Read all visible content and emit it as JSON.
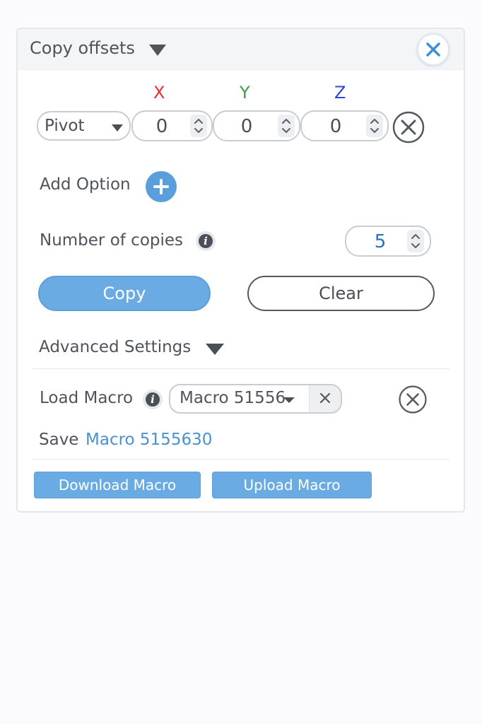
{
  "panel": {
    "title": "Copy offsets",
    "close_icon": "close-icon"
  },
  "axes": {
    "x": "X",
    "y": "Y",
    "z": "Z"
  },
  "axis_colors": {
    "x": "#e0322f",
    "y": "#3b9b4a",
    "z": "#2f47d9"
  },
  "offset_row": {
    "mode": "Pivot",
    "x": "0",
    "y": "0",
    "z": "0"
  },
  "add_option": {
    "label": "Add Option"
  },
  "copies": {
    "label": "Number of copies",
    "value": "5"
  },
  "actions": {
    "copy": "Copy",
    "clear": "Clear"
  },
  "advanced": {
    "label": "Advanced Settings"
  },
  "macro": {
    "load_label": "Load Macro",
    "selected": "Macro 51556",
    "save_label": "Save",
    "save_name": "Macro 5155630",
    "download": "Download Macro",
    "upload": "Upload Macro"
  },
  "colors": {
    "accent": "#6aabe3",
    "link": "#4b90d0"
  }
}
